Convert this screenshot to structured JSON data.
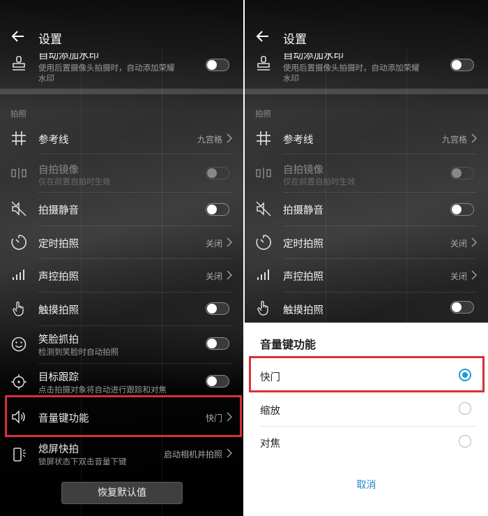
{
  "header": {
    "title": "设置"
  },
  "sections": {
    "photo": "拍照"
  },
  "items": {
    "watermark": {
      "label": "自动添加水印",
      "desc": "使用后置摄像头拍摄时，自动添加荣耀水印",
      "desc_line1": "使用后置摄像头拍摄时，自动添加荣耀",
      "desc_line2": "水印",
      "icon": "stamp-icon"
    },
    "grid": {
      "label": "参考线",
      "value": "九宫格",
      "icon": "grid-icon"
    },
    "mirror": {
      "label": "自拍镜像",
      "desc": "仅在前置自拍时生效",
      "icon": "mirror-icon"
    },
    "mute": {
      "label": "拍摄静音",
      "icon": "mute-icon"
    },
    "timer": {
      "label": "定时拍照",
      "value": "关闭",
      "icon": "timer-icon"
    },
    "voice": {
      "label": "声控拍照",
      "value": "关闭",
      "icon": "voice-bars-icon"
    },
    "touch": {
      "label": "触摸拍照",
      "icon": "touch-icon"
    },
    "smile": {
      "label": "笑脸抓拍",
      "desc": "检测到笑脸时自动拍照",
      "icon": "smile-icon"
    },
    "tracking": {
      "label": "目标跟踪",
      "desc": "点击拍摄对象将自动进行跟踪和对焦",
      "icon": "crosshair-icon"
    },
    "volume_key": {
      "label": "音量键功能",
      "value": "快门",
      "icon": "speaker-icon"
    },
    "screen_off": {
      "label": "熄屏快拍",
      "desc": "锁屏状态下双击音量下键",
      "value": "启动相机并拍照",
      "icon": "phone-icon"
    }
  },
  "restore_button": "恢复默认值",
  "dialog": {
    "title": "音量键功能",
    "options": [
      "快门",
      "缩放",
      "对焦"
    ],
    "selected": "快门",
    "cancel": "取消"
  },
  "colors": {
    "accent": "#1c9ad6",
    "highlight": "#d9303a"
  }
}
